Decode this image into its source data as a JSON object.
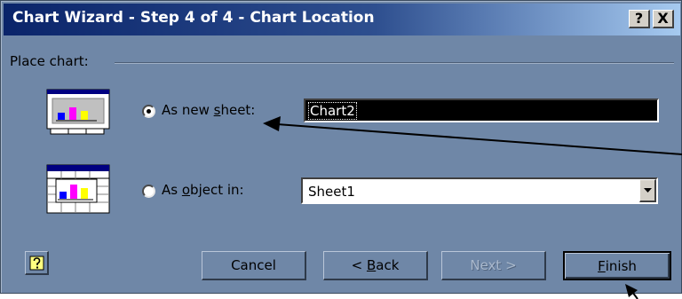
{
  "window": {
    "title": "Chart Wizard - Step 4 of 4 - Chart Location",
    "help_button": "?",
    "close_button": "X"
  },
  "group": {
    "label": "Place chart:"
  },
  "options": {
    "new_sheet": {
      "label_prefix": "As new ",
      "label_access": "s",
      "label_suffix": "heet:",
      "selected": true,
      "value": "Chart2"
    },
    "object_in": {
      "label_prefix": "As ",
      "label_access": "o",
      "label_suffix": "bject in:",
      "selected": false,
      "value": "Sheet1"
    }
  },
  "buttons": {
    "cancel": "Cancel",
    "back_prefix": "< ",
    "back_access": "B",
    "back_suffix": "ack",
    "next": "Next >",
    "finish_access": "F",
    "finish_suffix": "inish"
  },
  "colors": {
    "dialog_bg": "#6f87a7",
    "titlebar_start": "#0a246a",
    "titlebar_end": "#a6caf0",
    "bar_blue": "#0000ff",
    "bar_magenta": "#ff00ff",
    "bar_yellow": "#ffff00"
  }
}
